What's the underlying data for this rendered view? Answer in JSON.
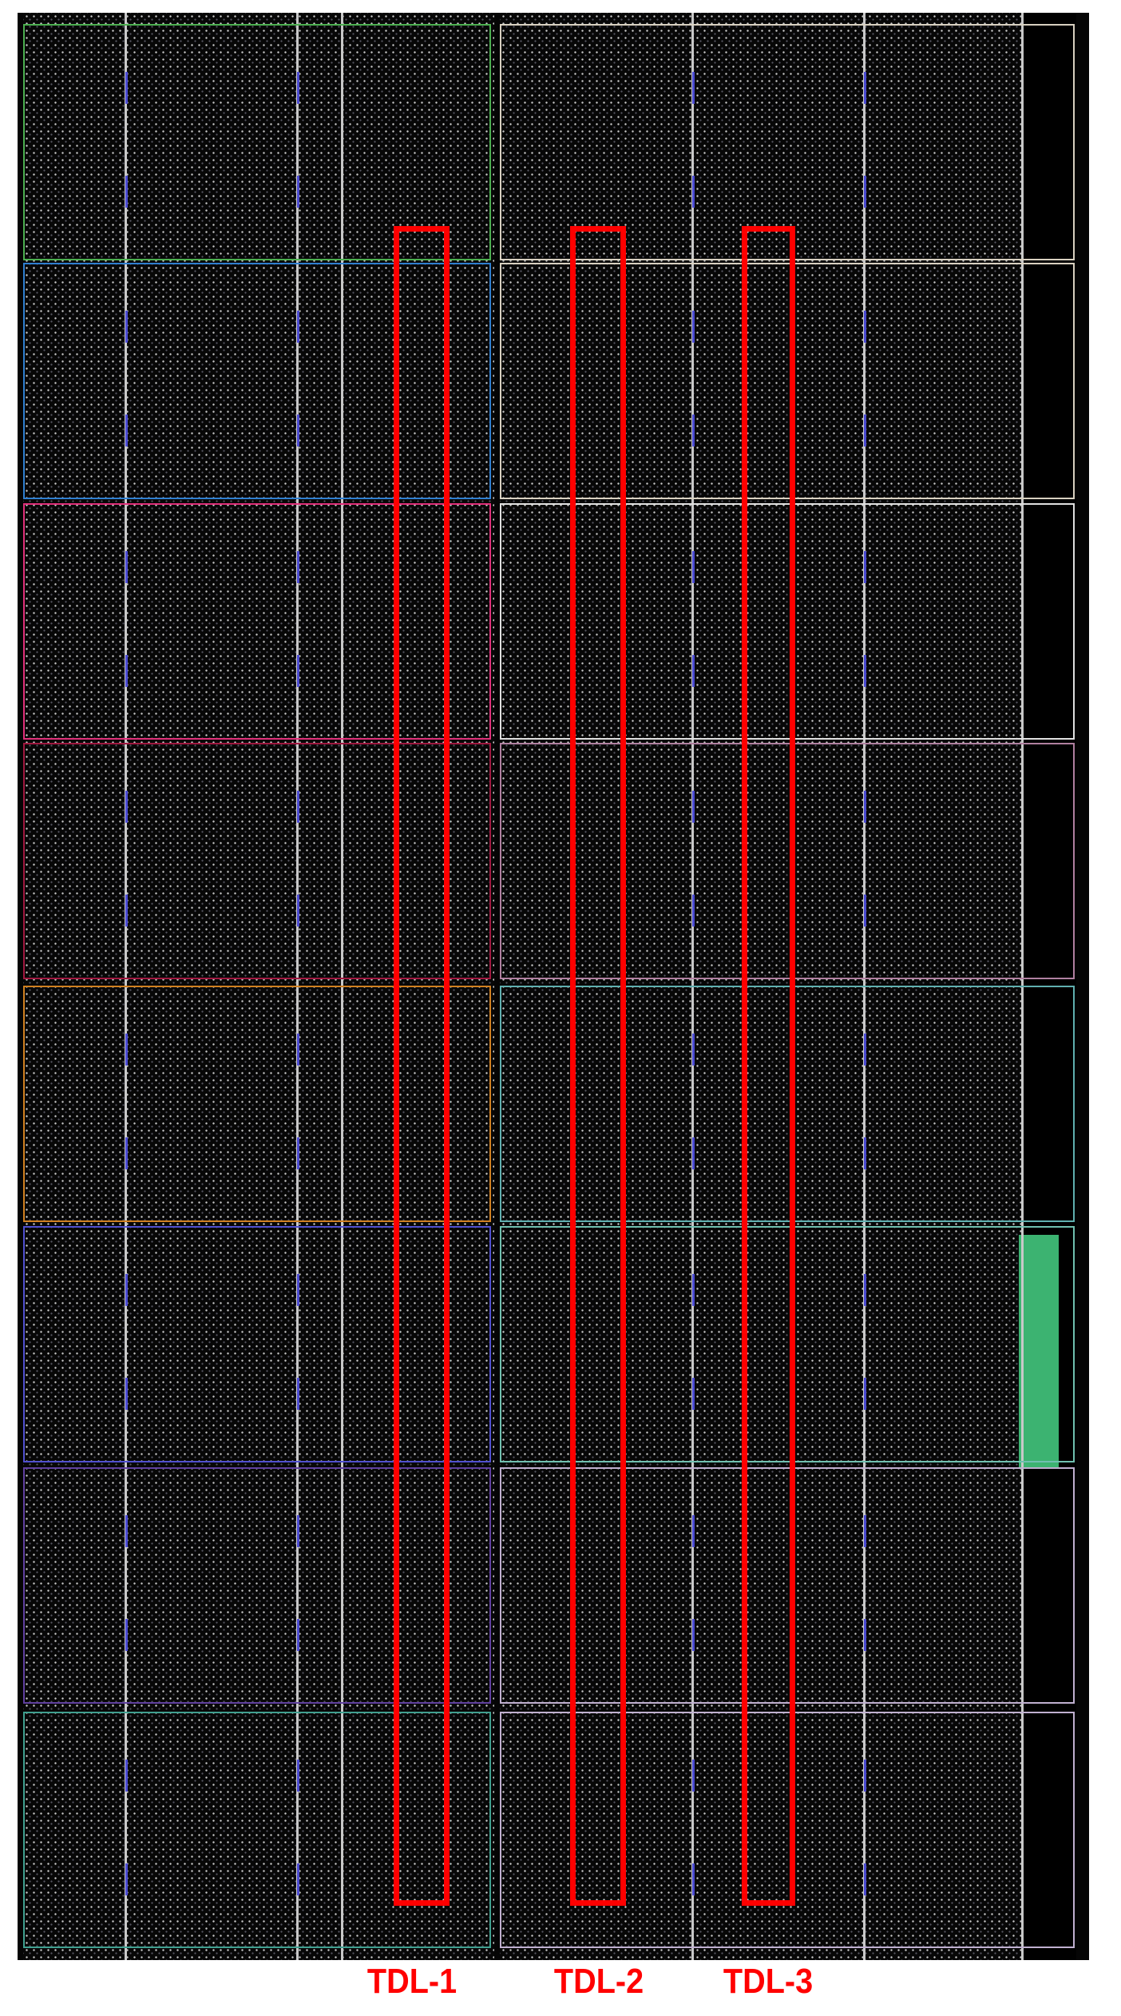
{
  "figure": {
    "labels": [
      "TDL-1",
      "TDL-2",
      "TDL-3"
    ],
    "colors": {
      "background": "#050505",
      "highlight": "#ff0000",
      "block_fill": "#3cb371",
      "left_region_borders": [
        "#4caf50",
        "#2f7fd0",
        "#e0307a",
        "#a01840",
        "#d08020",
        "#5050d0",
        "#6040a0",
        "#40a090"
      ],
      "right_region_borders": [
        "#d8d0c0",
        "#d8d0c0",
        "#e0e0e0",
        "#b080a0",
        "#60b0b0",
        "#70c0b0",
        "#c0b0d0",
        "#c0b0d0"
      ]
    }
  }
}
